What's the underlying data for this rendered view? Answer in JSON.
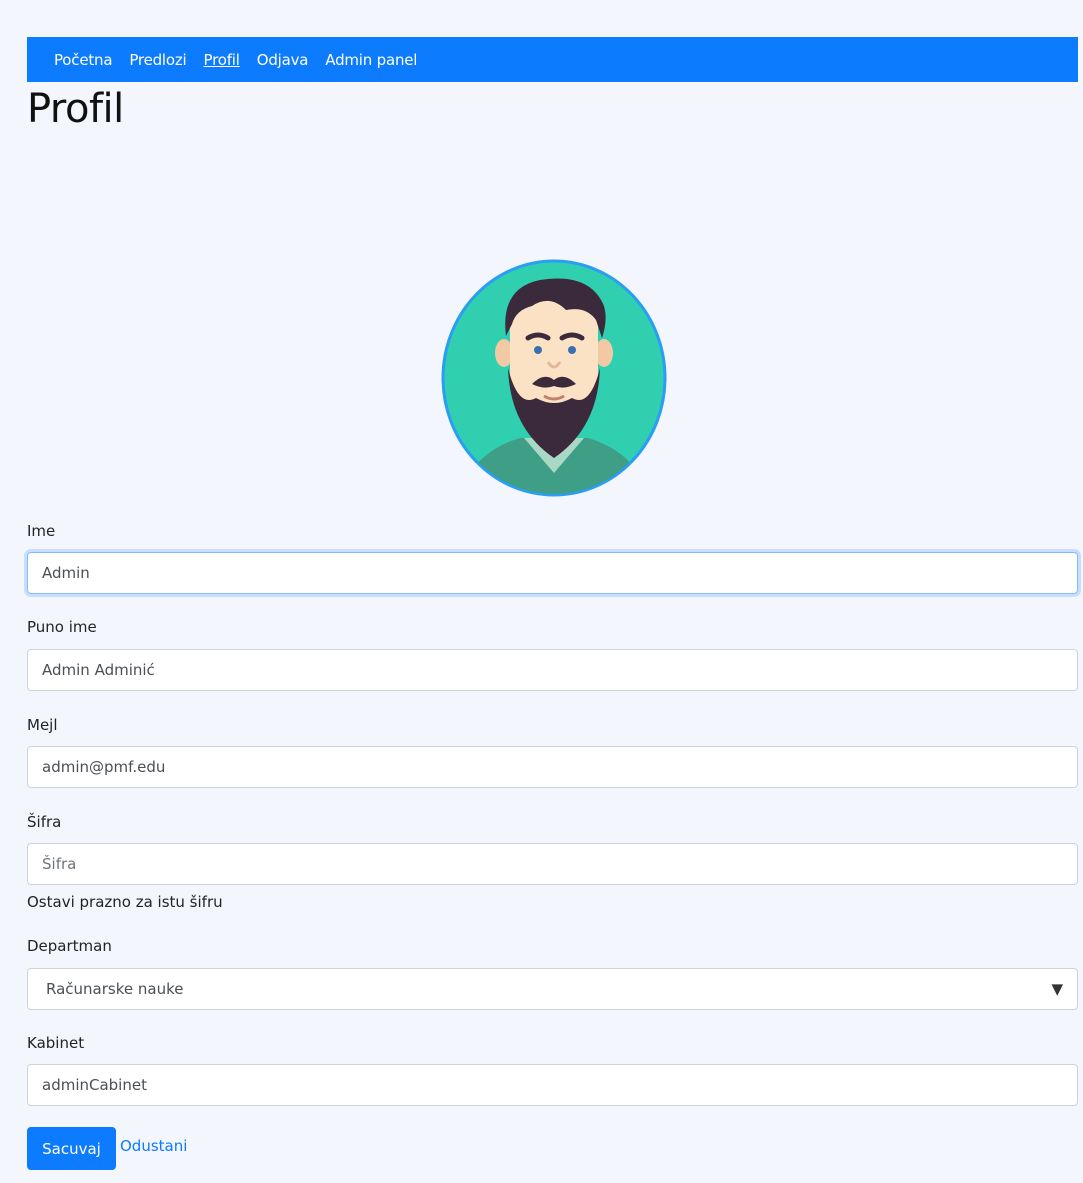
{
  "nav": {
    "items": [
      {
        "label": "Početna"
      },
      {
        "label": "Predlozi"
      },
      {
        "label": "Profil"
      },
      {
        "label": "Odjava"
      },
      {
        "label": "Admin panel"
      }
    ]
  },
  "page": {
    "title": "Profil"
  },
  "avatar": {
    "icon": "user-avatar-bearded-man",
    "bg_color": "#2fcfb0",
    "border_color": "#2a9df4"
  },
  "form": {
    "name": {
      "label": "Ime",
      "value": "Admin"
    },
    "full_name": {
      "label": "Puno ime",
      "value": "Admin Adminić"
    },
    "email": {
      "label": "Mejl",
      "value": "admin@pmf.edu"
    },
    "password": {
      "label": "Šifra",
      "value": "",
      "placeholder": "Šifra",
      "help": "Ostavi prazno za istu šifru"
    },
    "department": {
      "label": "Departman",
      "value": "Računarske nauke"
    },
    "office": {
      "label": "Kabinet",
      "value": "adminCabinet"
    },
    "save_label": "Sacuvaj",
    "cancel_label": "Odustani"
  },
  "colors": {
    "primary": "#0d7bfe",
    "background": "#f3f6fd"
  }
}
